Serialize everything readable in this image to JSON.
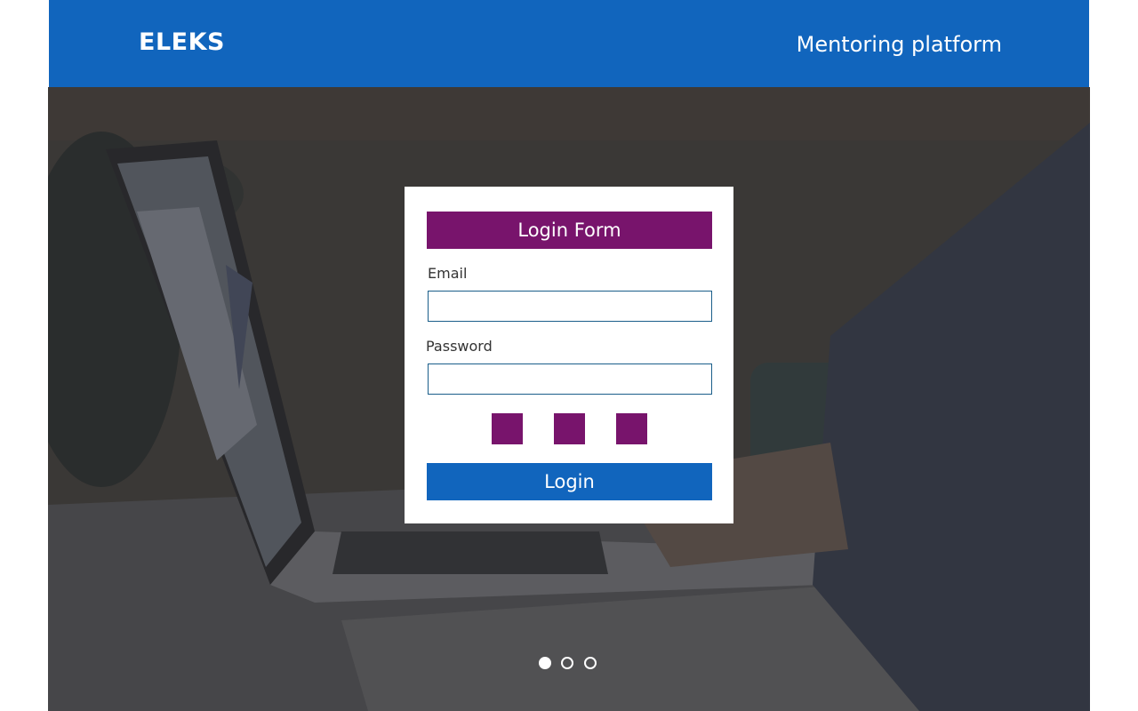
{
  "header": {
    "brand": "ELEKS",
    "tagline": "Mentoring platform",
    "background_color": "#1165bd"
  },
  "hero": {
    "image_description_icon": "laptop-photo"
  },
  "login_form": {
    "title": "Login Form",
    "title_color": "#78146c",
    "email_label": "Email",
    "email_value": "",
    "password_label": "Password",
    "password_value": "",
    "social_buttons": [
      {
        "icon": "social-icon-1",
        "color": "#78146c"
      },
      {
        "icon": "social-icon-2",
        "color": "#78146c"
      },
      {
        "icon": "social-icon-3",
        "color": "#78146c"
      }
    ],
    "login_label": "Login",
    "login_color": "#1165bd"
  },
  "carousel": {
    "slide_count": 3,
    "active_index": 0
  }
}
